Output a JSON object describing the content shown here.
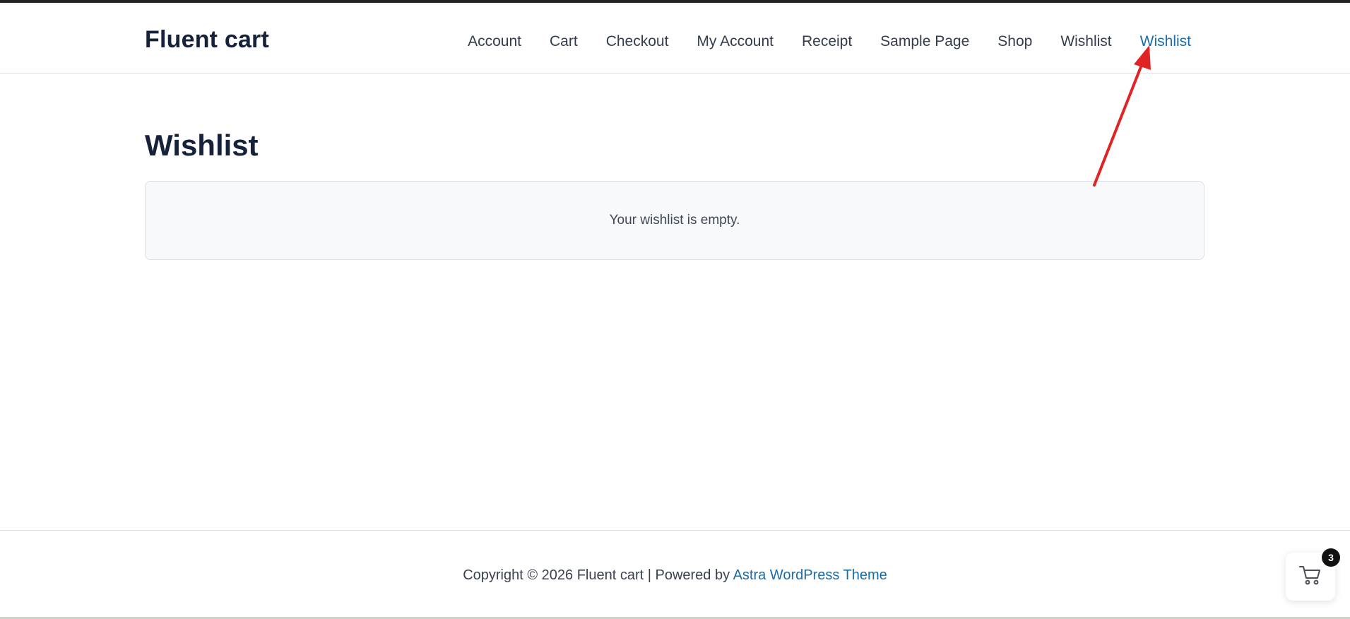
{
  "header": {
    "site_title": "Fluent cart",
    "nav": [
      {
        "label": "Account"
      },
      {
        "label": "Cart"
      },
      {
        "label": "Checkout"
      },
      {
        "label": "My Account"
      },
      {
        "label": "Receipt"
      },
      {
        "label": "Sample Page"
      },
      {
        "label": "Shop"
      },
      {
        "label": "Wishlist"
      },
      {
        "label": "Wishlist",
        "active": true
      }
    ]
  },
  "main": {
    "page_title": "Wishlist",
    "empty_message": "Your wishlist is empty."
  },
  "footer": {
    "copyright": "Copyright © 2026 Fluent cart | Powered by ",
    "theme_link": "Astra WordPress Theme"
  },
  "cart_widget": {
    "icon": "shopping-cart-icon",
    "count": "3"
  },
  "annotation": {
    "type": "arrow",
    "color": "#e02424"
  },
  "colors": {
    "accent": "#1a6ba8",
    "heading": "#16213a"
  }
}
